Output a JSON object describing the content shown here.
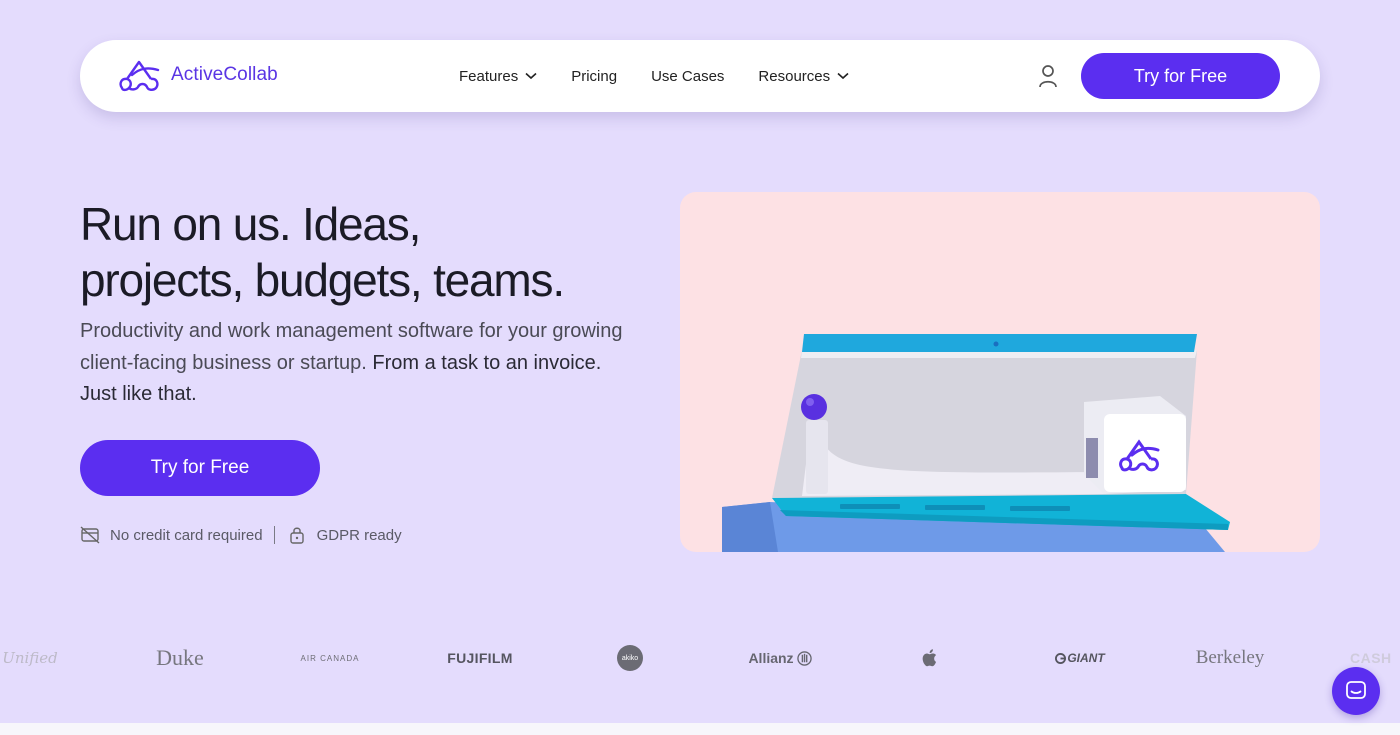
{
  "brand": {
    "name": "ActiveCollab",
    "color": "#5b2ef0"
  },
  "nav": {
    "items": [
      {
        "label": "Features",
        "has_dropdown": true
      },
      {
        "label": "Pricing",
        "has_dropdown": false
      },
      {
        "label": "Use Cases",
        "has_dropdown": false
      },
      {
        "label": "Resources",
        "has_dropdown": true
      }
    ],
    "user_icon": "user-icon",
    "cta_label": "Try for Free"
  },
  "hero": {
    "title_line1": "Run on us. Ideas,",
    "title_line2": "projects, budgets, teams.",
    "subtitle_regular": "Productivity and work management software for your growing client-facing business or startup. ",
    "subtitle_strong": "From a task to an invoice. Just like that.",
    "cta_label": "Try for Free",
    "badges": [
      {
        "icon": "no-credit-card-icon",
        "label": "No credit card required"
      },
      {
        "icon": "lock-icon",
        "label": "GDPR ready"
      }
    ]
  },
  "clients": [
    {
      "name": "Unified",
      "text": "Unified"
    },
    {
      "name": "Duke",
      "text": "Duke"
    },
    {
      "name": "Air Canada",
      "text": "AIR CANADA"
    },
    {
      "name": "Fujifilm",
      "text": "FUJIFILM"
    },
    {
      "name": "Akiko",
      "text": "akiko"
    },
    {
      "name": "Allianz",
      "text": "Allianz"
    },
    {
      "name": "Apple",
      "text": ""
    },
    {
      "name": "Giant",
      "text": "GIANT"
    },
    {
      "name": "Berkeley",
      "text": "Berkeley"
    },
    {
      "name": "Cash",
      "text": "CASH"
    }
  ],
  "chat": {
    "icon": "chat-icon"
  }
}
